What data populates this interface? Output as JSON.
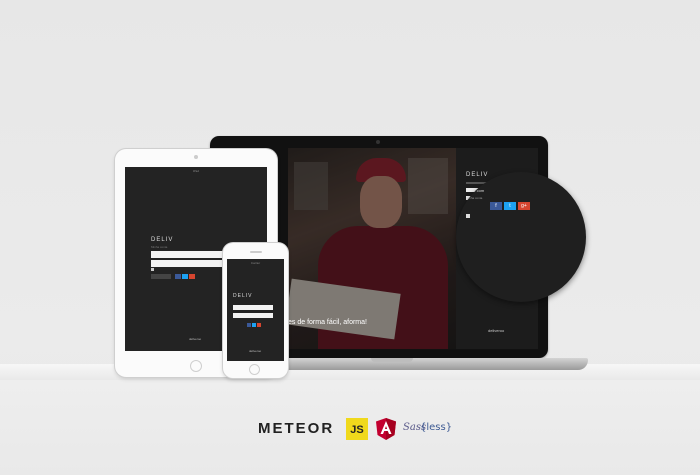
{
  "laptop": {
    "tagline": "es de forma fácil, aforma!",
    "panel_title": "DELIV",
    "panel_footer": "deliveroo",
    "zoom": {
      "title": "Entre com",
      "subtitle": "Minha conta",
      "social": [
        "f",
        "t",
        "g+"
      ]
    }
  },
  "tablet": {
    "status": "iPad",
    "logo": "DELIV",
    "subtitle": "Minha conta",
    "footer": "deliveroo"
  },
  "phone": {
    "status": "Carrier",
    "logo": "DELIV",
    "footer": "deliveroo"
  },
  "tech_logos": {
    "meteor": "METEOR",
    "js": "JS",
    "sass": "Sass",
    "less": "{less}"
  },
  "colors": {
    "facebook": "#3b5998",
    "twitter": "#1da1f2",
    "google": "#d6452f",
    "js_yellow": "#f0d91c",
    "angular_red": "#c3002f"
  }
}
